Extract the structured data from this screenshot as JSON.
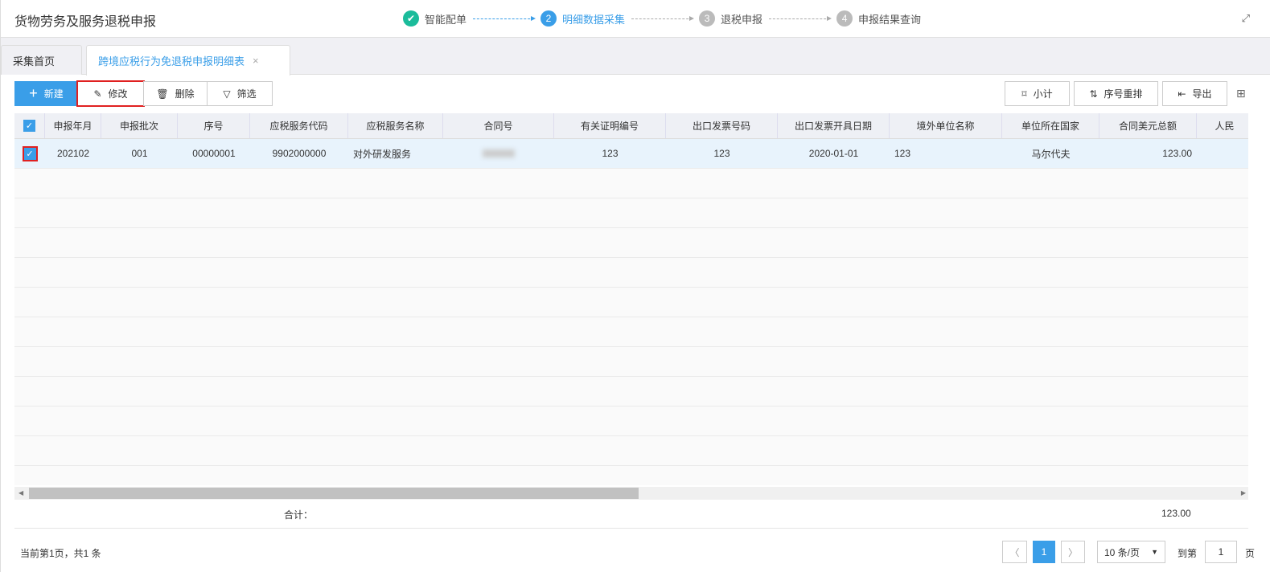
{
  "header": {
    "title": "货物劳务及服务退税申报",
    "steps": [
      {
        "num": "✔",
        "label": "智能配单",
        "state": "done"
      },
      {
        "num": "2",
        "label": "明细数据采集",
        "state": "active"
      },
      {
        "num": "3",
        "label": "退税申报",
        "state": "todo"
      },
      {
        "num": "4",
        "label": "申报结果查询",
        "state": "todo"
      }
    ],
    "fullscreen_icon": "⤢"
  },
  "tabs": [
    {
      "label": "采集首页"
    },
    {
      "label": "跨境应税行为免退税申报明细表",
      "close": "×"
    }
  ],
  "toolbar": {
    "new": "新建",
    "edit": "修改",
    "delete": "删除",
    "filter": "筛选",
    "subtotal": "小计",
    "renumber": "序号重排",
    "export": "导出"
  },
  "table": {
    "columns": [
      "申报年月",
      "申报批次",
      "序号",
      "应税服务代码",
      "应税服务名称",
      "合同号",
      "有关证明编号",
      "出口发票号码",
      "出口发票开具日期",
      "境外单位名称",
      "单位所在国家",
      "合同美元总额",
      "人民"
    ],
    "rows": [
      [
        "202102",
        "001",
        "00000001",
        "9902000000",
        "对外研发服务",
        "",
        "123",
        "123",
        "2020-01-01",
        "123",
        "马尔代夫",
        "123.00",
        ""
      ]
    ]
  },
  "totals": {
    "label": "合计：",
    "usd_total": "123.00"
  },
  "pagination": {
    "info": "当前第1页，共1 条",
    "current": "1",
    "page_size": "10 条/页",
    "goto_label": "到第",
    "goto_value": "1",
    "page_suffix": "页"
  }
}
